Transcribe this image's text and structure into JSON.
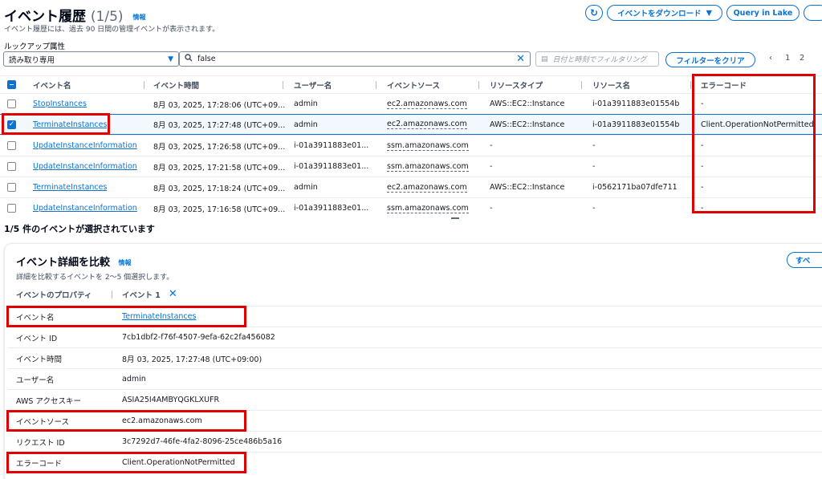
{
  "header": {
    "title": "イベント履歴",
    "count": "(1/5)",
    "info": "情報",
    "subtitle": "イベント履歴には、過去 90 日間の管理イベントが表示されます。",
    "download_label": "イベントをダウンロード",
    "query_lake_label": "Query in Lake"
  },
  "filter": {
    "lookup_label": "ルックアップ属性",
    "lookup_value": "読み取り専用",
    "search_value": "false",
    "date_placeholder": "日付と時刻でフィルタリング",
    "clear_filter_label": "フィルターをクリア",
    "pages": [
      "1",
      "2"
    ]
  },
  "events_table": {
    "columns": [
      "イベント名",
      "イベント時間",
      "ユーザー名",
      "イベントソース",
      "リソースタイプ",
      "リソース名",
      "エラーコード"
    ],
    "rows": [
      {
        "name": "StopInstances",
        "time": "8月 03, 2025, 17:28:06 (UTC+09...",
        "user": "admin",
        "source": "ec2.amazonaws.com",
        "rtype": "AWS::EC2::Instance",
        "rname": "i-01a3911883e01554b",
        "error": "-",
        "selected": false
      },
      {
        "name": "TerminateInstances",
        "time": "8月 03, 2025, 17:27:48 (UTC+09...",
        "user": "admin",
        "source": "ec2.amazonaws.com",
        "rtype": "AWS::EC2::Instance",
        "rname": "i-01a3911883e01554b",
        "error": "Client.OperationNotPermitted",
        "selected": true
      },
      {
        "name": "UpdateInstanceInformation",
        "time": "8月 03, 2025, 17:26:58 (UTC+09...",
        "user": "i-01a3911883e01...",
        "source": "ssm.amazonaws.com",
        "rtype": "-",
        "rname": "-",
        "error": "-",
        "selected": false
      },
      {
        "name": "UpdateInstanceInformation",
        "time": "8月 03, 2025, 17:21:58 (UTC+09...",
        "user": "i-01a3911883e01...",
        "source": "ssm.amazonaws.com",
        "rtype": "-",
        "rname": "-",
        "error": "-",
        "selected": false
      },
      {
        "name": "TerminateInstances",
        "time": "8月 03, 2025, 17:18:24 (UTC+09...",
        "user": "admin",
        "source": "ec2.amazonaws.com",
        "rtype": "AWS::EC2::Instance",
        "rname": "i-0562171ba07dfe711",
        "error": "-",
        "selected": false
      },
      {
        "name": "UpdateInstanceInformation",
        "time": "8月 03, 2025, 17:16:58 (UTC+09...",
        "user": "i-01a3911883e01...",
        "source": "ssm.amazonaws.com",
        "rtype": "-",
        "rname": "-",
        "error": "-",
        "selected": false
      }
    ]
  },
  "selection_text": "1/5 件のイベントが選択されています",
  "compare": {
    "title": "イベント詳細を比較",
    "info": "情報",
    "subtitle": "詳細を比較するイベントを 2〜5 個選択します。",
    "all_label": "すべ",
    "col_property": "イベントのプロパティ",
    "col_event1": "イベント 1",
    "rows": [
      {
        "label": "イベント名",
        "value": "TerminateInstances",
        "link": true
      },
      {
        "label": "イベント ID",
        "value": "7cb1dbf2-f76f-4507-9efa-62c2fa456082",
        "link": false
      },
      {
        "label": "イベント時間",
        "value": "8月 03, 2025, 17:27:48 (UTC+09:00)",
        "link": false
      },
      {
        "label": "ユーザー名",
        "value": "admin",
        "link": false
      },
      {
        "label": "AWS アクセスキー",
        "value": "ASIA25I4AMBYQGKLXUFR",
        "link": false
      },
      {
        "label": "イベントソース",
        "value": "ec2.amazonaws.com",
        "link": false
      },
      {
        "label": "リクエスト ID",
        "value": "3c7292d7-46fe-4fa2-8096-25ce486b5a16",
        "link": false
      },
      {
        "label": "エラーコード",
        "value": "Client.OperationNotPermitted",
        "link": false
      }
    ]
  },
  "colors": {
    "accent": "#0972d3",
    "highlight": "#e00000"
  }
}
